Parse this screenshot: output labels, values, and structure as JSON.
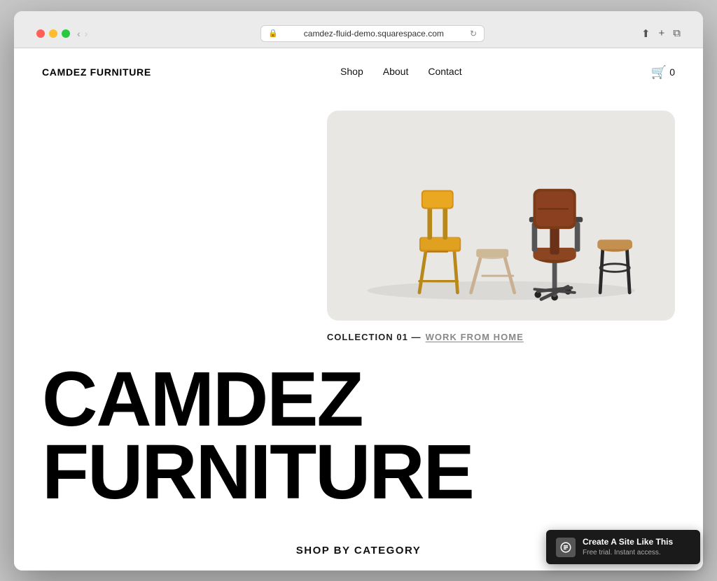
{
  "browser": {
    "url": "camdez-fluid-demo.squarespace.com",
    "back_icon": "◀",
    "forward_icon": "▶",
    "lock_icon": "🔒",
    "refresh_icon": "↻",
    "share_icon": "⬆",
    "new_tab_icon": "+",
    "window_icon": "⧉"
  },
  "nav": {
    "logo": "CAMDEZ FURNITURE",
    "links": [
      {
        "label": "Shop"
      },
      {
        "label": "About"
      },
      {
        "label": "Contact"
      }
    ],
    "cart_count": "0"
  },
  "hero": {
    "collection_prefix": "COLLECTION 01 —",
    "collection_link": "WORK FROM HOME"
  },
  "brand": {
    "headline": "CAMDEZ FURNITURE"
  },
  "shop_section": {
    "title": "SHOP BY CATEGORY"
  },
  "squarespace_banner": {
    "title": "Create A Site Like This",
    "subtitle": "Free trial. Instant access."
  }
}
